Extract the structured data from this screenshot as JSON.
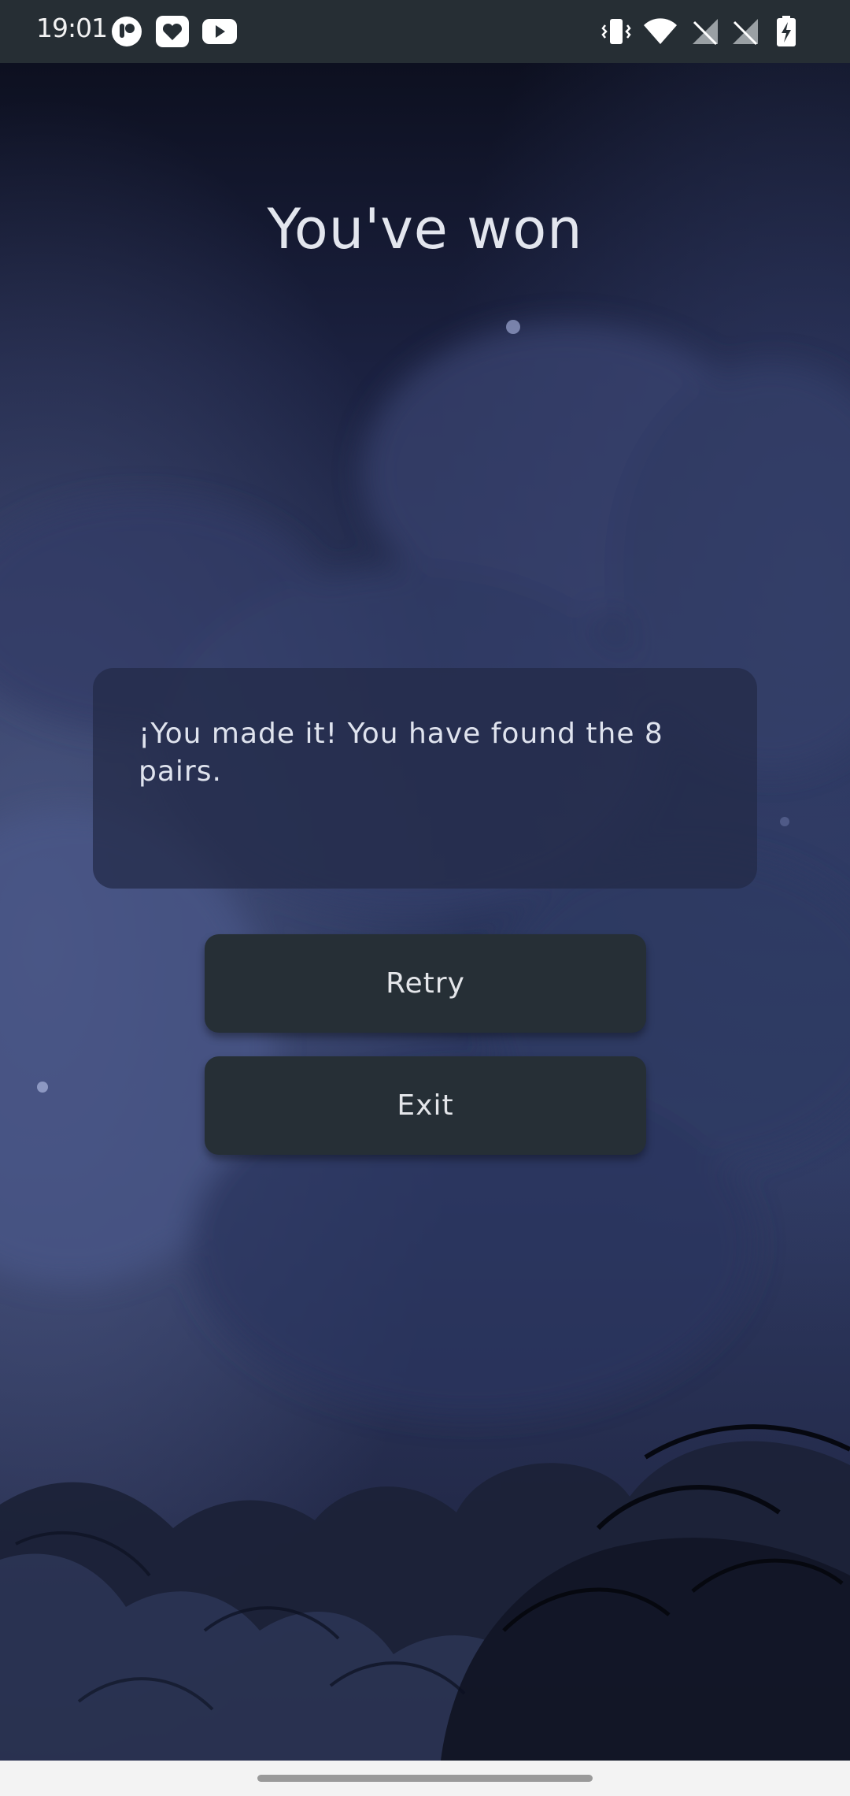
{
  "status_bar": {
    "time": "19:01",
    "left_icons": [
      "podcast-app-icon",
      "heart-app-icon",
      "youtube-icon"
    ],
    "right_icons": [
      "vibrate-icon",
      "wifi-icon",
      "no-signal-icon",
      "no-signal-icon",
      "battery-charging-icon"
    ]
  },
  "game_over": {
    "title": "You've won",
    "message": "¡You made it! You have found the 8 pairs.",
    "retry_label": "Retry",
    "exit_label": "Exit"
  },
  "colors": {
    "status_bar_bg": "#262e34",
    "button_bg": "#262f36",
    "background_blue": "#1e2540",
    "nav_bar_bg": "#f3f3f3"
  }
}
